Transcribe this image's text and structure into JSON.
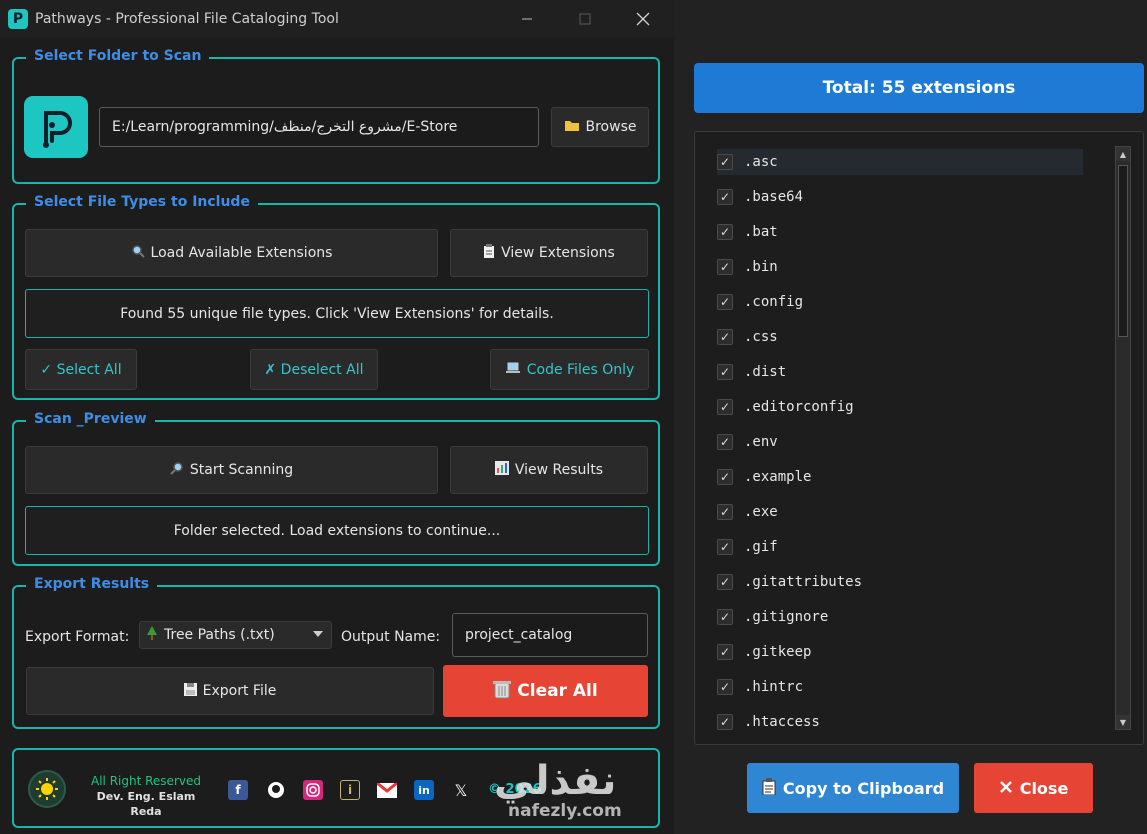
{
  "window": {
    "title": "Pathways - Professional File Cataloging Tool",
    "app_letter": "P"
  },
  "folder_group": {
    "title": "Select Folder to Scan",
    "path": "E:/Learn/programming/مشروع التخرج/منظف/E-Store",
    "browse_icon": "folder-icon",
    "browse_label": "Browse"
  },
  "types_group": {
    "title": "Select File Types to Include",
    "load_label": "Load Available Extensions",
    "view_label": "View Extensions",
    "info_text": "Found 55 unique file types. Click 'View Extensions' for details.",
    "select_all": "✓ Select All",
    "deselect_all": "✗ Deselect All",
    "code_only": "Code Files Only"
  },
  "scan_group": {
    "title": "Scan _Preview",
    "start_label": "Start Scanning",
    "view_results_label": "View Results",
    "status_text": "Folder selected. Load extensions to continue..."
  },
  "export_group": {
    "title": "Export Results",
    "format_label": "Export Format:",
    "format_value": "Tree Paths (.txt)",
    "output_label": "Output Name:",
    "output_value": "project_catalog",
    "export_label": "Export File",
    "clear_label": "Clear All"
  },
  "footer": {
    "rights": "All Right Reserved",
    "dev": "Dev. Eng. Eslam Reda",
    "copyright": "© 2026",
    "socials": [
      "facebook-icon",
      "github-icon",
      "instagram-icon",
      "info-icon",
      "gmail-icon",
      "linkedin-icon",
      "x-icon"
    ]
  },
  "extensions_panel": {
    "total": "Total: 55 extensions",
    "items": [
      ".asc",
      ".base64",
      ".bat",
      ".bin",
      ".config",
      ".css",
      ".dist",
      ".editorconfig",
      ".env",
      ".example",
      ".exe",
      ".gif",
      ".gitattributes",
      ".gitignore",
      ".gitkeep",
      ".hintrc",
      ".htaccess"
    ],
    "check_mark": "✓",
    "copy_label": "Copy to Clipboard",
    "close_label": "Close"
  },
  "watermark": {
    "arabic": "نفذلي",
    "latin": "nafezly.com"
  },
  "colors": {
    "accent": "#18b5ad",
    "label_blue": "#3e8ee8",
    "total_bar": "#1f7ad6",
    "danger": "#e64535",
    "copy_btn": "#2f86d2"
  }
}
